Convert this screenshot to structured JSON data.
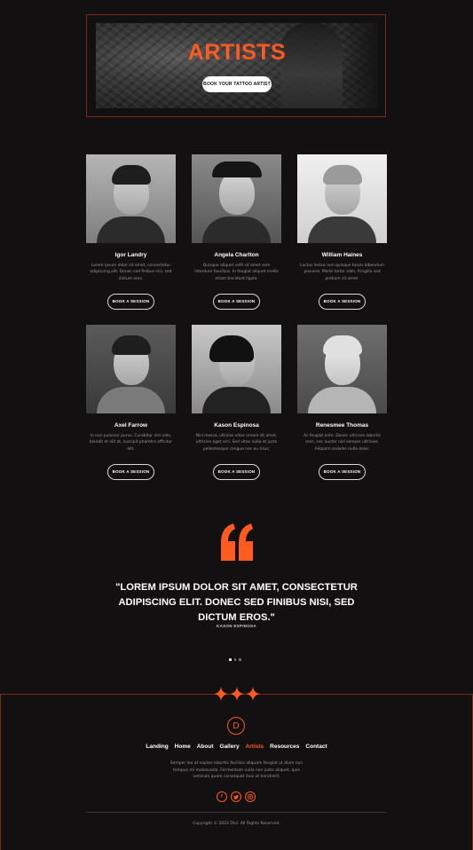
{
  "hero": {
    "title": "ARTISTS",
    "cta_label": "BOOK YOUR TATTOO ARTIST"
  },
  "artists": [
    {
      "name": "Igor Landry",
      "bio": "Lorem ipsum dolor sit amet, consectetur adipiscing elit. Donec sed finibus nisi, sed dictum eros.",
      "button": "BOOK A SESSION"
    },
    {
      "name": "Angela Charlton",
      "bio": "Quisque aliquet velit sit amet sem interdum faucibus. In feugiat aliquet mollis etiam tincidunt ligula.",
      "button": "BOOK A SESSION"
    },
    {
      "name": "William Haines",
      "bio": "Luctus lectus non quisque turpis bibendum posuere. Morbi tortor nibh, fringilla sed pretium sit amet.",
      "button": "BOOK A SESSION"
    },
    {
      "name": "Axel Farrow",
      "bio": "In non pulvinar purus. Curabitur nisi odio, blandit et elit at, suscipit pharetra efficitur elit.",
      "button": "BOOK A SESSION"
    },
    {
      "name": "Kason Espinosa",
      "bio": "Nisl massa, ultrices vitae ornare sit amet, ultricies eget orci. Sed vitae nulla et justo pellentesque congue nec eu risus.",
      "button": "BOOK A SESSION"
    },
    {
      "name": "Renesmee Thomas",
      "bio": "Ac feugiat ante. Donec ultricies lobortis eros, nec auctor nisl semper ultricies. Aliquam sodales nulla dolor.",
      "button": "BOOK A SESSION"
    }
  ],
  "testimonial": {
    "quote": "\"LOREM IPSUM DOLOR SIT AMET, CONSECTETUR ADIPISCING ELIT. DONEC SED FINIBUS NISI, SED DICTUM EROS.\"",
    "author": "KASON ESPINOSA"
  },
  "footer": {
    "logo_letter": "D",
    "nav": [
      "Landing",
      "Home",
      "About",
      "Gallery",
      "Artists",
      "Resources",
      "Contact"
    ],
    "active_nav": "Artists",
    "text": "Semper leo at sapien lobortis facilisis aliquam feugiat ut diam non tempus mi malesuada. Fermentum nulla non justo aliquet, quis vehicula quam consequat duis ut hendrerit.",
    "socials": [
      "facebook-icon",
      "twitter-icon",
      "instagram-icon"
    ],
    "copyright": "Copyright © 2022 Divi. All Rights Reserved."
  },
  "colors": {
    "accent": "#ff5a1f",
    "background": "#121010",
    "border": "#7a2a16"
  }
}
